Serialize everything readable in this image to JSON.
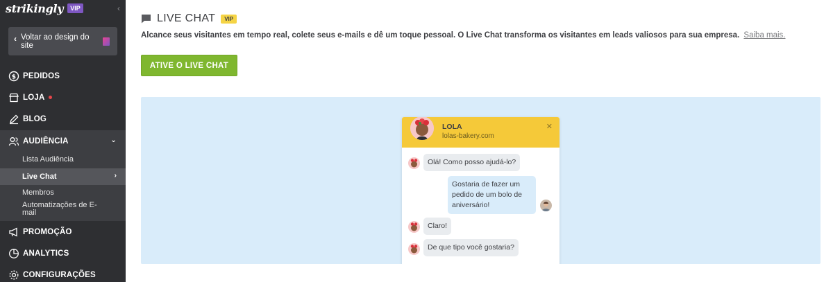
{
  "brand": {
    "logo": "strikingly",
    "badge": "VIP"
  },
  "sidebar": {
    "back_label": "Voltar ao design do site",
    "items": [
      {
        "label": "PEDIDOS",
        "icon": "dollar-circle-icon"
      },
      {
        "label": "LOJA",
        "icon": "store-icon"
      },
      {
        "label": "BLOG",
        "icon": "pen-icon"
      },
      {
        "label": "AUDIÊNCIA",
        "icon": "users-icon"
      },
      {
        "label": "PROMOÇÃO",
        "icon": "megaphone-icon"
      },
      {
        "label": "ANALYTICS",
        "icon": "pie-chart-icon"
      },
      {
        "label": "CONFIGURAÇÕES",
        "icon": "gear-icon"
      }
    ],
    "subitems": [
      {
        "label": "Lista Audiência"
      },
      {
        "label": "Live Chat"
      },
      {
        "label": "Membros"
      },
      {
        "label": "Automatizações de E-mail"
      }
    ]
  },
  "main": {
    "title": "LIVE CHAT",
    "title_badge": "VIP",
    "description": "Alcance seus visitantes em tempo real, colete seus e-mails e dê um toque pessoal. O Live Chat transforma os visitantes em leads valiosos para sua empresa.",
    "learn_more": "Saiba mais.",
    "cta": "ATIVE O LIVE CHAT"
  },
  "widget": {
    "agent_name": "LOLA",
    "agent_site": "lolas-bakery.com",
    "messages": [
      {
        "from": "agent",
        "text": "Olá! Como posso ajudá-lo?"
      },
      {
        "from": "user",
        "text": "Gostaria de fazer um pedido de um bolo de aniversário!"
      },
      {
        "from": "agent",
        "text": "Claro!"
      },
      {
        "from": "agent",
        "text": "De que tipo você gostaria?"
      }
    ]
  },
  "colors": {
    "sidebar_bg": "#2e2f32",
    "accent_green": "#7fb72f",
    "vip_purple": "#7e57c2",
    "widget_header": "#f5c939",
    "preview_bg": "#d9ecfa",
    "notification_dot": "#e8464a"
  }
}
